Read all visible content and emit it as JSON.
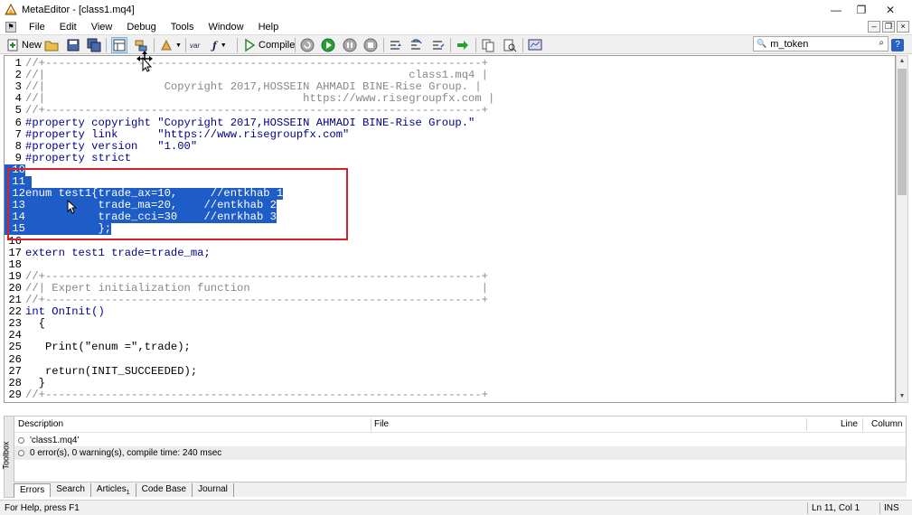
{
  "window": {
    "title": "MetaEditor - [class1.mq4]",
    "controls": [
      "—",
      "❐",
      "✕"
    ]
  },
  "menu": [
    "File",
    "Edit",
    "View",
    "Debug",
    "Tools",
    "Window",
    "Help"
  ],
  "toolbar": {
    "new_label": "New",
    "compile_label": "Compile",
    "var_label": "var",
    "search_value": "m_token"
  },
  "code_lines": [
    {
      "n": "1",
      "text": "//+------------------------------------------------------------------+",
      "kind": "comment"
    },
    {
      "n": "2",
      "text": "//|                                                       class1.mq4 |",
      "kind": "comment"
    },
    {
      "n": "3",
      "text": "//|                  Copyright 2017,HOSSEIN AHMADI BINE-Rise Group. |",
      "kind": "comment"
    },
    {
      "n": "4",
      "text": "//|                                       https://www.risegroupfx.com |",
      "kind": "comment"
    },
    {
      "n": "5",
      "text": "//+------------------------------------------------------------------+",
      "kind": "comment"
    },
    {
      "n": "6",
      "text": "#property copyright \"Copyright 2017,HOSSEIN AHMADI BINE-Rise Group.\"",
      "kind": "kw"
    },
    {
      "n": "7",
      "text": "#property link      \"https://www.risegroupfx.com\"",
      "kind": "kw"
    },
    {
      "n": "8",
      "text": "#property version   \"1.00\"",
      "kind": "kw"
    },
    {
      "n": "9",
      "text": "#property strict",
      "kind": "kw"
    },
    {
      "n": "10",
      "text": "",
      "kind": "plain",
      "sel": true
    },
    {
      "n": "11",
      "text": " ",
      "kind": "plain",
      "sel": true
    },
    {
      "n": "12",
      "text": "enum test1{trade_ax=10,     //entkhab 1",
      "kind": "plain",
      "sel": true
    },
    {
      "n": "13",
      "text": "           trade_ma=20,    //entkhab 2",
      "kind": "plain",
      "sel": true
    },
    {
      "n": "14",
      "text": "           trade_cci=30    //enrkhab 3",
      "kind": "plain",
      "sel": true
    },
    {
      "n": "15",
      "text": "           };",
      "kind": "plain",
      "sel": true
    },
    {
      "n": "16",
      "text": "",
      "kind": "plain"
    },
    {
      "n": "17",
      "text": "extern test1 trade=trade_ma;",
      "kind": "kw"
    },
    {
      "n": "18",
      "text": "",
      "kind": "plain"
    },
    {
      "n": "19",
      "text": "//+------------------------------------------------------------------+",
      "kind": "comment"
    },
    {
      "n": "20",
      "text": "//| Expert initialization function                                   |",
      "kind": "comment"
    },
    {
      "n": "21",
      "text": "//+------------------------------------------------------------------+",
      "kind": "comment"
    },
    {
      "n": "22",
      "text": "int OnInit()",
      "kind": "kw"
    },
    {
      "n": "23",
      "text": "  {",
      "kind": "plain"
    },
    {
      "n": "24",
      "text": "",
      "kind": "plain"
    },
    {
      "n": "25",
      "text": "   Print(\"enum =\",trade);",
      "kind": "plain"
    },
    {
      "n": "26",
      "text": "",
      "kind": "plain"
    },
    {
      "n": "27",
      "text": "   return(INIT_SUCCEEDED);",
      "kind": "plain"
    },
    {
      "n": "28",
      "text": "  }",
      "kind": "plain"
    },
    {
      "n": "29",
      "text": "//+------------------------------------------------------------------+",
      "kind": "comment"
    }
  ],
  "errors": {
    "headers": {
      "description": "Description",
      "file": "File",
      "line": "Line",
      "column": "Column"
    },
    "rows": [
      "'class1.mq4'",
      "0 error(s), 0 warning(s), compile time: 240 msec"
    ]
  },
  "toolbox_label": "Toolbox",
  "tabs": [
    "Errors",
    "Search",
    "Articles",
    "Code Base",
    "Journal"
  ],
  "articles_badge": "1",
  "status": {
    "help": "For Help, press F1",
    "position": "Ln 11, Col 1",
    "mode": "INS"
  },
  "colors": {
    "selection": "#1e5cc8",
    "highlight_box": "#d8202b",
    "comment": "#888888",
    "keyword": "#00008b"
  }
}
